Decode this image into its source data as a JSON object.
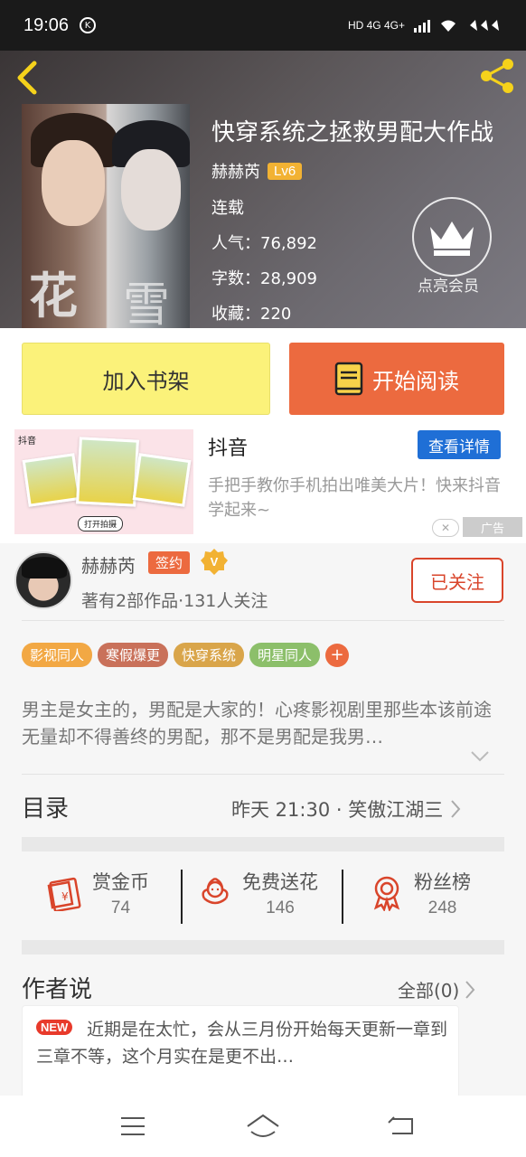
{
  "status": {
    "time": "19:06",
    "network": "HD 4G 4G+"
  },
  "book": {
    "title": "快穿系统之拯救男配大作战",
    "author": "赫赫芮",
    "level": "Lv6",
    "state": "连载",
    "popularity": "人气：76,892",
    "words": "字数：28,909",
    "favorites": "收藏：220",
    "vip_label": "点亮会员",
    "cover_text_1": "花",
    "cover_text_2": "雪"
  },
  "actions": {
    "shelf": "加入书架",
    "read": "开始阅读"
  },
  "ad": {
    "brand_small": "抖音",
    "title": "抖音",
    "button": "查看详情",
    "desc": "手把手教你手机拍出唯美大片！快来抖音学起来~",
    "img_tag": "打开拍摄",
    "close": "✕",
    "label": "广告"
  },
  "author_block": {
    "name": "赫赫芮",
    "sign": "签约",
    "works": "著有2部作品·131人关注",
    "follow": "已关注"
  },
  "tags": [
    {
      "label": "影视同人",
      "color": "#f2a844"
    },
    {
      "label": "寒假爆更",
      "color": "#c9715a"
    },
    {
      "label": "快穿系统",
      "color": "#d9a54a"
    },
    {
      "label": "明星同人",
      "color": "#8cbf6a"
    }
  ],
  "tag_more": "+",
  "description": "男主是女主的，男配是大家的！心疼影视剧里那些本该前途无量却不得善终的男配，那不是男配是我男…",
  "toc": {
    "label": "目录",
    "latest": "昨天 21:30 · 笑傲江湖三"
  },
  "stats": [
    {
      "label": "赏金币",
      "value": "74",
      "icon": "red-envelope-icon"
    },
    {
      "label": "免费送花",
      "value": "146",
      "icon": "flower-icon"
    },
    {
      "label": "粉丝榜",
      "value": "248",
      "icon": "medal-icon"
    }
  ],
  "author_say": {
    "label": "作者说",
    "all": "全部(0)",
    "new": "NEW",
    "text": "近期是在太忙，会从三月份开始每天更新一章到三章不等，这个月实在是更不出…"
  },
  "colors": {
    "accent": "#ec6a3f",
    "shelf": "#fbf27a",
    "ad_button": "#1f6fd6",
    "follow": "#d9452b",
    "level": "#f2b233"
  }
}
